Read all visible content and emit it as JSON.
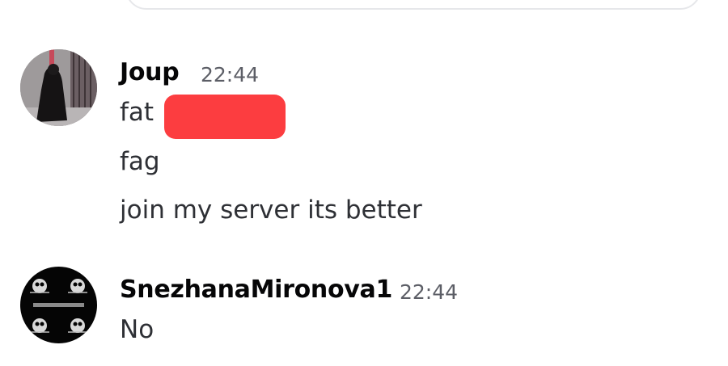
{
  "messages": [
    {
      "username": "Joup",
      "time": "22:44",
      "avatar_icon": "person-in-dark-coat-avatar",
      "lines": [
        "fat",
        "fag",
        "join my server its better"
      ],
      "redaction_color": "#fc3d40"
    },
    {
      "username": "SnezhanaMironova1",
      "time": "22:44",
      "avatar_icon": "skull-emblem-avatar",
      "lines": [
        "No"
      ]
    }
  ]
}
